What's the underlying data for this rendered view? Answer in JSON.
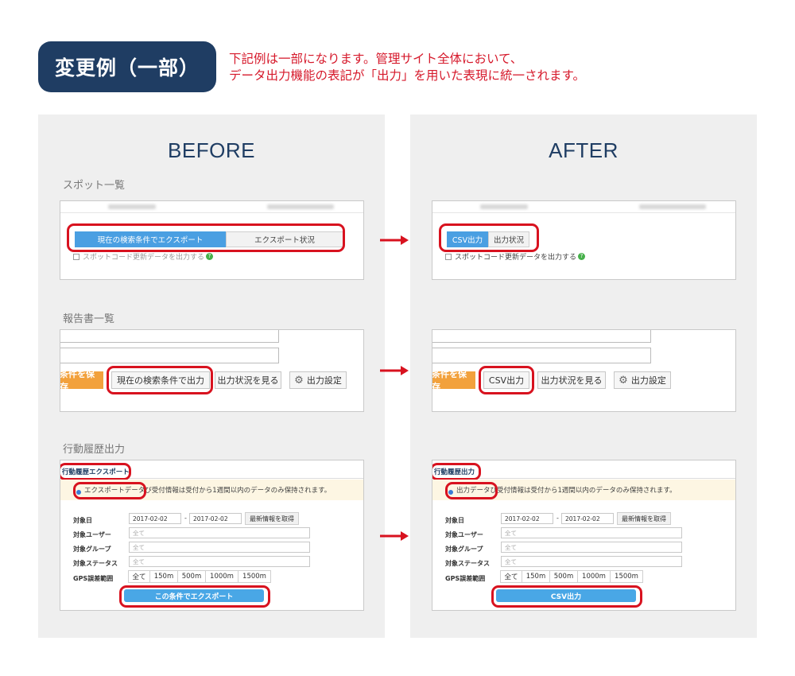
{
  "header": {
    "badge": "変更例（一部）",
    "note_line1": "下記例は一部になります。管理サイト全体において、",
    "note_line2": "データ出力機能の表記が「出力」を用いた表現に統一されます。"
  },
  "colors": {
    "navy": "#1f3d63",
    "red": "#d6192b",
    "blue_button": "#49a7e6",
    "orange_button": "#f2a13c",
    "panel_bg": "#efefef"
  },
  "before": {
    "title": "BEFORE",
    "spot": {
      "label": "スポット一覧",
      "tab_active": "現在の検索条件でエクスポート",
      "tab_inactive": "エクスポート状況",
      "checkbox_text": "スポットコード更新データを出力する"
    },
    "report": {
      "label": "報告書一覧",
      "save_button": "条件を保存",
      "export_button": "現在の検索条件で出力",
      "status_button": "出力状況を見る",
      "settings_button": "出力設定"
    },
    "history": {
      "label": "行動履歴出力",
      "tab_title": "行動履歴エクスポート",
      "info_highlight": "エクスポートデータ",
      "info_rest": "び受付情報は受付から1週間以内のデータのみ保持されます。",
      "fields": {
        "date_label": "対象日",
        "date_from": "2017-02-02",
        "date_to": "2017-02-02",
        "fetch_button": "最新情報を取得",
        "user_label": "対象ユーザー",
        "user_placeholder": "全て",
        "group_label": "対象グループ",
        "group_placeholder": "全て",
        "status_label": "対象ステータス",
        "status_placeholder": "全て",
        "gps_label": "GPS誤差範囲",
        "gps_options": [
          "全て",
          "150m",
          "500m",
          "1000m",
          "1500m"
        ]
      },
      "export_button": "この条件でエクスポート"
    }
  },
  "after": {
    "title": "AFTER",
    "spot": {
      "label": "",
      "tab_active": "CSV出力",
      "tab_inactive": "出力状況",
      "checkbox_text": "スポットコード更新データを出力する"
    },
    "report": {
      "save_button": "条件を保存",
      "export_button": "CSV出力",
      "status_button": "出力状況を見る",
      "settings_button": "出力設定"
    },
    "history": {
      "tab_title": "行動履歴出力",
      "info_highlight": "出力データ",
      "info_rest": "び受付情報は受付から1週間以内のデータのみ保持されます。",
      "fields": {
        "date_label": "対象日",
        "date_from": "2017-02-02",
        "date_to": "2017-02-02",
        "fetch_button": "最新情報を取得",
        "user_label": "対象ユーザー",
        "user_placeholder": "全て",
        "group_label": "対象グループ",
        "group_placeholder": "全て",
        "status_label": "対象ステータス",
        "status_placeholder": "全て",
        "gps_label": "GPS誤差範囲",
        "gps_options": [
          "全て",
          "150m",
          "500m",
          "1000m",
          "1500m"
        ]
      },
      "export_button": "CSV出力"
    }
  }
}
